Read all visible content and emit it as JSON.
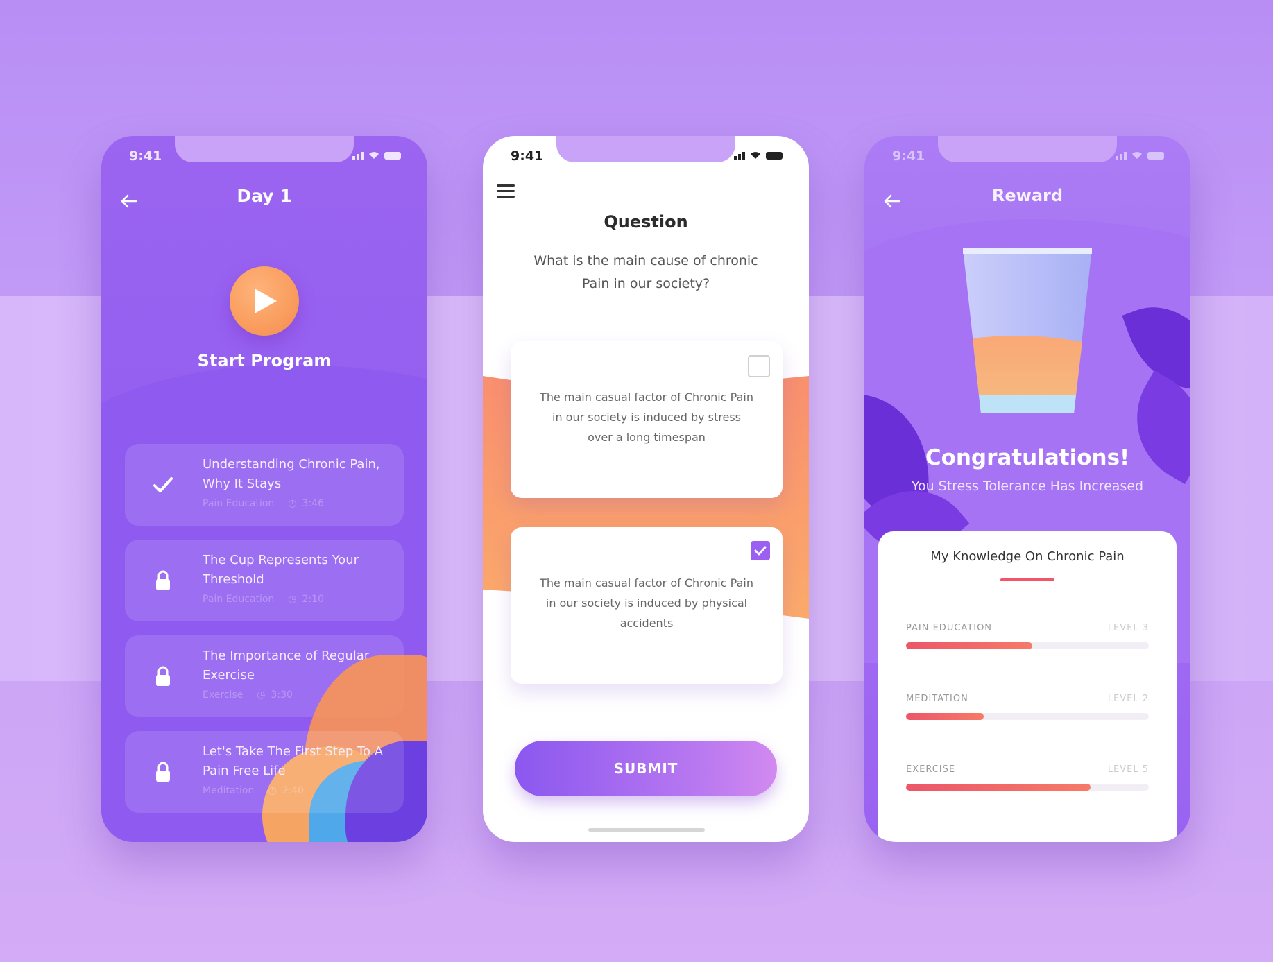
{
  "status_bar": {
    "time": "9:41"
  },
  "screen_day": {
    "title": "Day 1",
    "start_label": "Start Program",
    "lessons": [
      {
        "title": "Understanding Chronic Pain, Why It Stays",
        "category": "Pain Education",
        "duration": "3:46",
        "status": "completed",
        "icon": "check-icon"
      },
      {
        "title": "The Cup Represents Your Threshold",
        "category": "Pain Education",
        "duration": "2:10",
        "status": "locked",
        "icon": "lock-icon"
      },
      {
        "title": "The Importance of Regular Exercise",
        "category": "Exercise",
        "duration": "3:30",
        "status": "locked",
        "icon": "lock-icon"
      },
      {
        "title": "Let's Take The First Step To A Pain Free Life",
        "category": "Meditation",
        "duration": "2:40",
        "status": "locked",
        "icon": "lock-icon"
      }
    ]
  },
  "screen_question": {
    "title": "Question",
    "question": "What is the main cause of chronic Pain in our society?",
    "options": [
      {
        "text": "The main casual factor of Chronic Pain in our society is induced by stress over a long timespan",
        "checked": false
      },
      {
        "text": "The main casual factor of Chronic Pain in our society is induced by physical accidents",
        "checked": true
      }
    ],
    "submit_label": "SUBMIT"
  },
  "screen_reward": {
    "title": "Reward",
    "congrats": "Congratulations!",
    "subtitle": "You Stress Tolerance Has Increased",
    "card_title": "My Knowledge On Chronic Pain",
    "skills": [
      {
        "name": "PAIN EDUCATION",
        "level": "LEVEL 3",
        "progress": 0.52
      },
      {
        "name": "MEDITATION",
        "level": "LEVEL 2",
        "progress": 0.32
      },
      {
        "name": "EXERCISE",
        "level": "LEVEL 5",
        "progress": 0.76
      }
    ]
  },
  "colors": {
    "primary_purple": "#8a55ee",
    "accent_orange": "#f99d5e",
    "progress_red": "#ec5669",
    "background": "#c9a3f7"
  }
}
